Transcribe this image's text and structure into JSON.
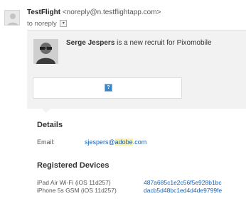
{
  "message": {
    "sender_name": "TestFlight",
    "sender_email": "<noreply@n.testflightapp.com>",
    "recipient_prefix": "to",
    "recipient": "noreply",
    "toggle_glyph": "▾"
  },
  "card": {
    "recruit_name": "Serge Jespers",
    "recruit_text": " is a new recruit for Pixomobile",
    "image_placeholder": "?"
  },
  "details": {
    "title": "Details",
    "email_label": "Email:",
    "email_user": "sjespers@",
    "email_domain": "adobe",
    "email_tld": ".com"
  },
  "devices": {
    "title": "Registered Devices",
    "items": [
      {
        "name": "iPad Air Wi-Fi (iOS 11d257)",
        "id": "487a685c1e2c56f5e928b1bc"
      },
      {
        "name": "iPhone 5s GSM (iOS 11d257)",
        "id": "dacb5d48bc1ed4d4de9799fe"
      }
    ]
  },
  "colors": {
    "link": "#1a5fb4",
    "highlight": "#fbf2a8",
    "card_bg": "#f2f2f2"
  }
}
